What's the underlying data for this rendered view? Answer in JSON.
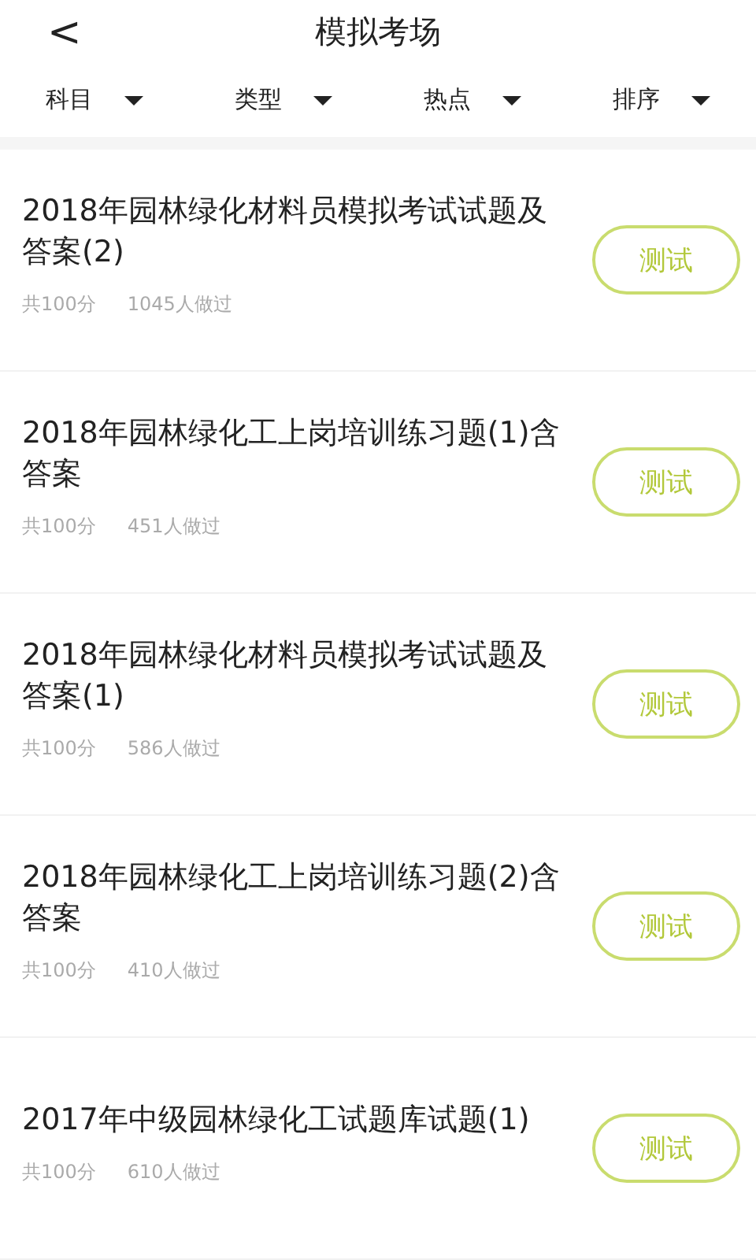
{
  "header": {
    "back": "<",
    "title": "模拟考场"
  },
  "filters": [
    {
      "label": "科目"
    },
    {
      "label": "类型"
    },
    {
      "label": "热点"
    },
    {
      "label": "排序"
    }
  ],
  "exams": [
    {
      "title": "2018年园林绿化材料员模拟考试试题及答案(2)",
      "score": "共100分",
      "taken": "1045人做过",
      "button": "测试"
    },
    {
      "title": "2018年园林绿化工上岗培训练习题(1)含答案",
      "score": "共100分",
      "taken": "451人做过",
      "button": "测试"
    },
    {
      "title": "2018年园林绿化材料员模拟考试试题及答案(1)",
      "score": "共100分",
      "taken": "586人做过",
      "button": "测试"
    },
    {
      "title": "2018年园林绿化工上岗培训练习题(2)含答案",
      "score": "共100分",
      "taken": "410人做过",
      "button": "测试"
    },
    {
      "title": "2017年中级园林绿化工试题库试题(1)",
      "score": "共100分",
      "taken": "610人做过",
      "button": "测试"
    }
  ]
}
